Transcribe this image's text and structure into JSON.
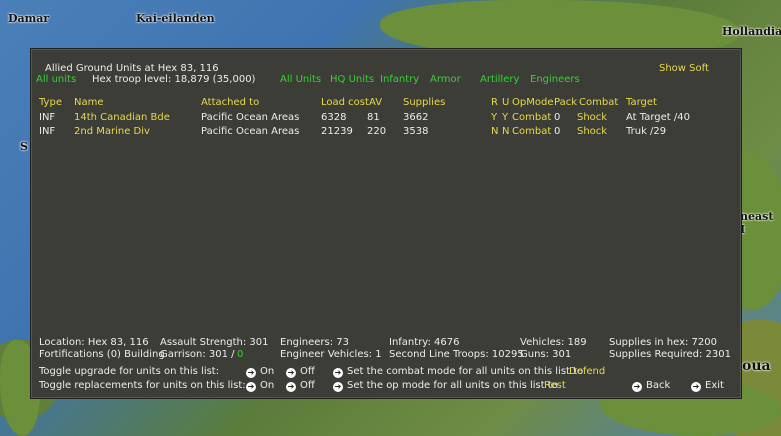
{
  "map": {
    "labels": [
      "Damar",
      "Kai-eilanden",
      "Hollandia",
      "neast I",
      "oua",
      "S"
    ]
  },
  "dialog": {
    "title": "Allied Ground Units at Hex 83, 116",
    "all_units_left": "All units",
    "hex_troop_level": "Hex troop level: 18,879  (35,000)",
    "show_soft": "Show Soft",
    "filters": [
      "All Units",
      "HQ Units",
      "Infantry",
      "Armor",
      "Artillery",
      "Engineers"
    ],
    "columns": {
      "type": "Type",
      "name": "Name",
      "attached": "Attached to",
      "load_cost": "Load cost",
      "av": "AV",
      "supplies": "Supplies",
      "r": "R",
      "u": "U",
      "opmode": "OpMode",
      "pack": "Pack",
      "combat": "Combat",
      "target": "Target"
    },
    "rows": [
      {
        "type": "INF",
        "name": "14th Canadian Bde",
        "attached": "Pacific Ocean Areas",
        "load_cost": "6328",
        "av": "81",
        "supplies": "3662",
        "r": "Y",
        "u": "Y",
        "opmode": "Combat",
        "pack": "0",
        "combat": "Shock",
        "target": "At Target /40"
      },
      {
        "type": "INF",
        "name": "2nd Marine Div",
        "attached": "Pacific Ocean Areas",
        "load_cost": "21239",
        "av": "220",
        "supplies": "3538",
        "r": "N",
        "u": "N",
        "opmode": "Combat",
        "pack": "0",
        "combat": "Shock",
        "target": "Truk /29"
      }
    ],
    "summary": {
      "location": "Location: Hex 83, 116",
      "fortifications": "Fortifications (0) Building",
      "assault_strength": "Assault Strength: 301",
      "garrison_label": "Garrison: 301  /",
      "garrison_value": "0",
      "engineers": "Engineers: 73",
      "engineer_vehicles": "Engineer Vehicles: 1",
      "infantry": "Infantry: 4676",
      "second_line": "Second Line Troops: 10295",
      "vehicles": "Vehicles: 189",
      "guns": "Guns: 301",
      "supplies_in_hex": "Supplies in hex: 7200",
      "supplies_required": "Supplies Required: 2301"
    },
    "controls": {
      "toggle_upgrade": "Toggle upgrade for units on this list:",
      "toggle_replacements": "Toggle replacements for units on this list:",
      "on": "On",
      "off": "Off",
      "set_combat_mode": "Set the combat mode for all units on this list to",
      "combat_mode_value": "Defend",
      "set_op_mode": "Set the op mode for all units on this list to",
      "op_mode_value": "Rest",
      "back": "Back",
      "exit": "Exit"
    }
  }
}
